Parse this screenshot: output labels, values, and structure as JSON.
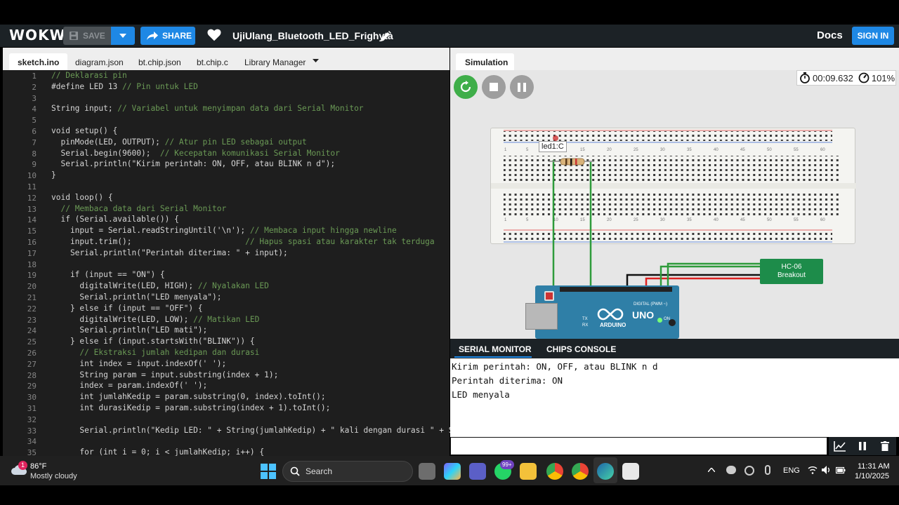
{
  "header": {
    "logo": "WOKWi",
    "save_label": "SAVE",
    "share_label": "SHARE",
    "project_name": "UjiUlang_Bluetooth_LED_Frighyta",
    "docs_label": "Docs",
    "signin_label": "SIGN IN"
  },
  "editor_tabs": [
    "sketch.ino",
    "diagram.json",
    "bt.chip.json",
    "bt.chip.c",
    "Library Manager"
  ],
  "code": {
    "line_numbers": [
      "1",
      "2",
      "3",
      "4",
      "5",
      "6",
      "7",
      "8",
      "9",
      "10",
      "11",
      "12",
      "13",
      "14",
      "15",
      "16",
      "17",
      "18",
      "19",
      "20",
      "21",
      "22",
      "23",
      "24",
      "25",
      "26",
      "27",
      "28",
      "29",
      "30",
      "31",
      "32",
      "33",
      "34",
      "35"
    ],
    "lines": [
      "// Deklarasi pin",
      "#define LED 13 // Pin untuk LED",
      "",
      "String input; // Variabel untuk menyimpan data dari Serial Monitor",
      "",
      "void setup() {",
      "  pinMode(LED, OUTPUT); // Atur pin LED sebagai output",
      "  Serial.begin(9600);  // Kecepatan komunikasi Serial Monitor",
      "  Serial.println(\"Kirim perintah: ON, OFF, atau BLINK n d\");",
      "}",
      "",
      "void loop() {",
      "  // Membaca data dari Serial Monitor",
      "  if (Serial.available()) {",
      "    input = Serial.readStringUntil('\\n'); // Membaca input hingga newline",
      "    input.trim();                        // Hapus spasi atau karakter tak terduga",
      "    Serial.println(\"Perintah diterima: \" + input);",
      "",
      "    if (input == \"ON\") {",
      "      digitalWrite(LED, HIGH); // Nyalakan LED",
      "      Serial.println(\"LED menyala\");",
      "    } else if (input == \"OFF\") {",
      "      digitalWrite(LED, LOW); // Matikan LED",
      "      Serial.println(\"LED mati\");",
      "    } else if (input.startsWith(\"BLINK\")) {",
      "      // Ekstraksi jumlah kedipan dan durasi",
      "      int index = input.indexOf(' ');",
      "      String param = input.substring(index + 1);",
      "      index = param.indexOf(' ');",
      "      int jumlahKedip = param.substring(0, index).toInt();",
      "      int durasiKedip = param.substring(index + 1).toInt();",
      "",
      "      Serial.println(\"Kedip LED: \" + String(jumlahKedip) + \" kali dengan durasi \" + Stri",
      "",
      "      for (int i = 0; i < jumlahKedip; i++) {"
    ]
  },
  "simulation": {
    "tab_label": "Simulation",
    "timer": "00:09.632",
    "speed": "101%",
    "led_label": "led1:C",
    "module_name_line1": "HC-06",
    "module_name_line2": "Breakout",
    "board_brand": "ARDUINO",
    "board_model": "UNO",
    "digital_label": "DIGITAL (PWM ~)",
    "on_label": "ON",
    "tx_label": "TX",
    "rx_label": "RX",
    "ruler_numbers": [
      "1",
      "5",
      "10",
      "15",
      "20",
      "25",
      "30",
      "35",
      "40",
      "45",
      "50",
      "55",
      "60"
    ]
  },
  "serial": {
    "tabs": [
      "SERIAL MONITOR",
      "CHIPS CONSOLE"
    ],
    "output": [
      "Kirim perintah: ON, OFF, atau BLINK n d",
      "Perintah diterima: ON",
      "LED menyala"
    ],
    "input_value": ""
  },
  "taskbar": {
    "weather_temp": "86°F",
    "weather_desc": "Mostly cloudy",
    "weather_badge": "1",
    "search_label": "Search",
    "whatsapp_badge": "99+",
    "lang": "ENG",
    "time": "11:31 AM",
    "date": "1/10/2025"
  },
  "colors": {
    "accent": "#1e88e5",
    "header_bg": "#1c2226",
    "editor_bg": "#1e1e1e",
    "restart_green": "#3fae49",
    "wire_green": "#2e9b3b",
    "board_blue": "#2f7fa7"
  }
}
